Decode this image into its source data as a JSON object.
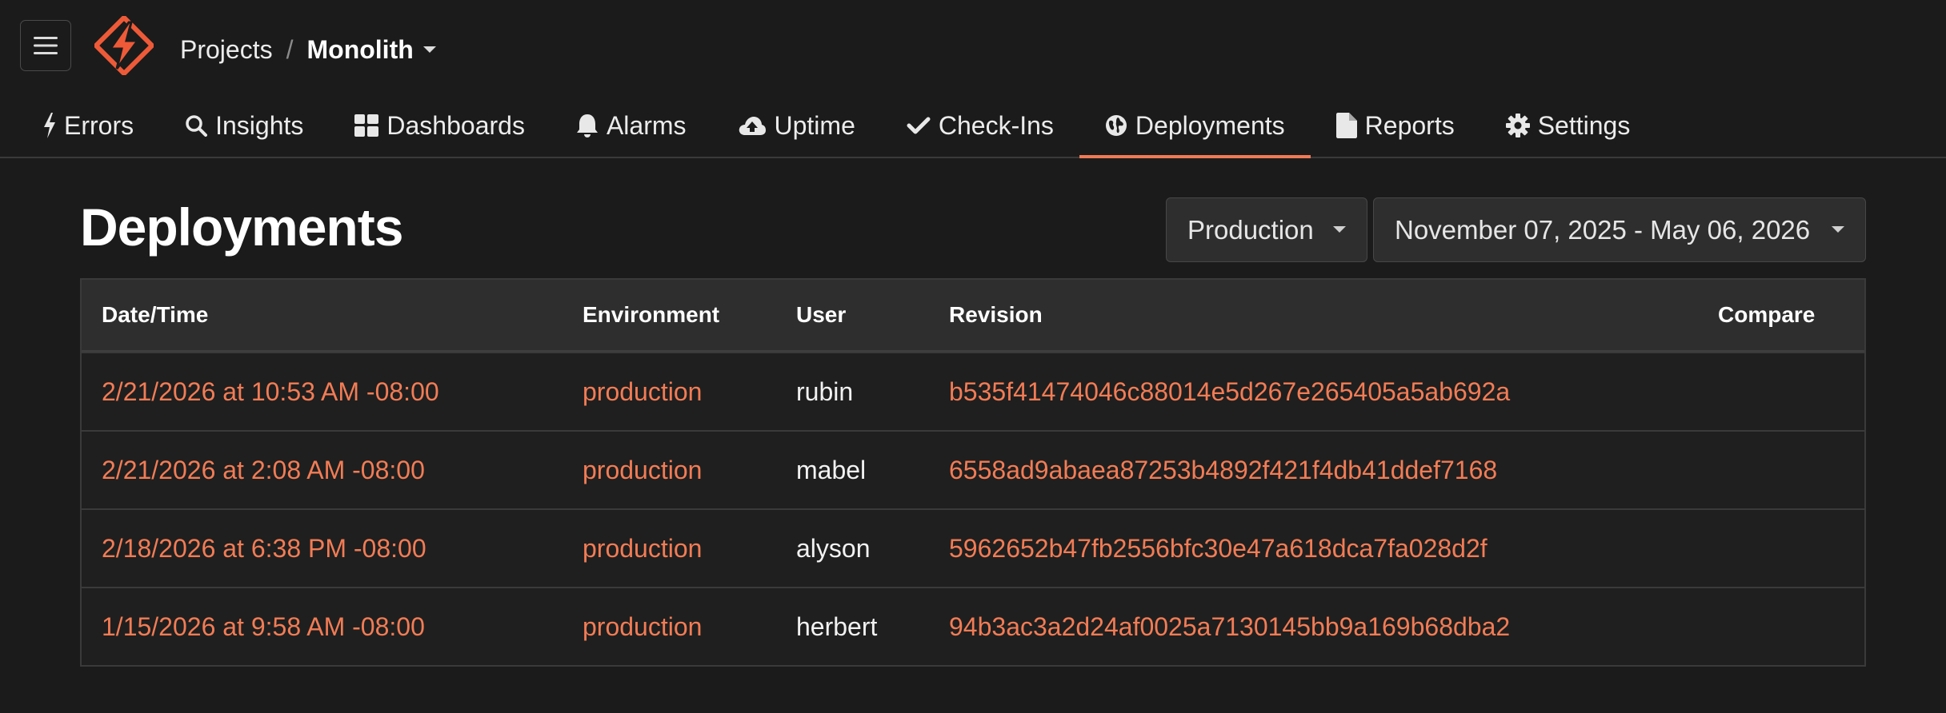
{
  "header": {
    "breadcrumb": {
      "projects": "Projects",
      "separator": "/",
      "current": "Monolith"
    },
    "menu_icon": "hamburger-icon",
    "logo_icon": "lightning-bolt-logo"
  },
  "nav": {
    "tabs": [
      {
        "label": "Errors",
        "icon": "bolt-icon",
        "active": false
      },
      {
        "label": "Insights",
        "icon": "search-icon",
        "active": false
      },
      {
        "label": "Dashboards",
        "icon": "grid-icon",
        "active": false
      },
      {
        "label": "Alarms",
        "icon": "bell-icon",
        "active": false
      },
      {
        "label": "Uptime",
        "icon": "cloud-upload-icon",
        "active": false
      },
      {
        "label": "Check-Ins",
        "icon": "check-icon",
        "active": false
      },
      {
        "label": "Deployments",
        "icon": "globe-icon",
        "active": true
      },
      {
        "label": "Reports",
        "icon": "file-icon",
        "active": false
      },
      {
        "label": "Settings",
        "icon": "gear-icon",
        "active": false
      }
    ]
  },
  "page": {
    "title": "Deployments",
    "environment_filter": "Production",
    "date_range": "November 07, 2025 - May 06, 2026"
  },
  "table": {
    "columns": [
      "Date/Time",
      "Environment",
      "User",
      "Revision",
      "Compare"
    ],
    "rows": [
      {
        "datetime": "2/21/2026 at 10:53 AM -08:00",
        "environment": "production",
        "user": "rubin",
        "revision": "b535f41474046c88014e5d267e265405a5ab692a",
        "compare": ""
      },
      {
        "datetime": "2/21/2026 at 2:08 AM -08:00",
        "environment": "production",
        "user": "mabel",
        "revision": "6558ad9abaea87253b4892f421f4db41ddef7168",
        "compare": ""
      },
      {
        "datetime": "2/18/2026 at 6:38 PM -08:00",
        "environment": "production",
        "user": "alyson",
        "revision": "5962652b47fb2556bfc30e47a618dca7fa028d2f",
        "compare": ""
      },
      {
        "datetime": "1/15/2026 at 9:58 AM -08:00",
        "environment": "production",
        "user": "herbert",
        "revision": "94b3ac3a2d24af0025a7130145bb9a169b68dba2",
        "compare": ""
      }
    ]
  },
  "colors": {
    "accent": "#f07a55",
    "link": "#f27c55",
    "background": "#1b1b1b",
    "surface": "#2e2e2e"
  }
}
